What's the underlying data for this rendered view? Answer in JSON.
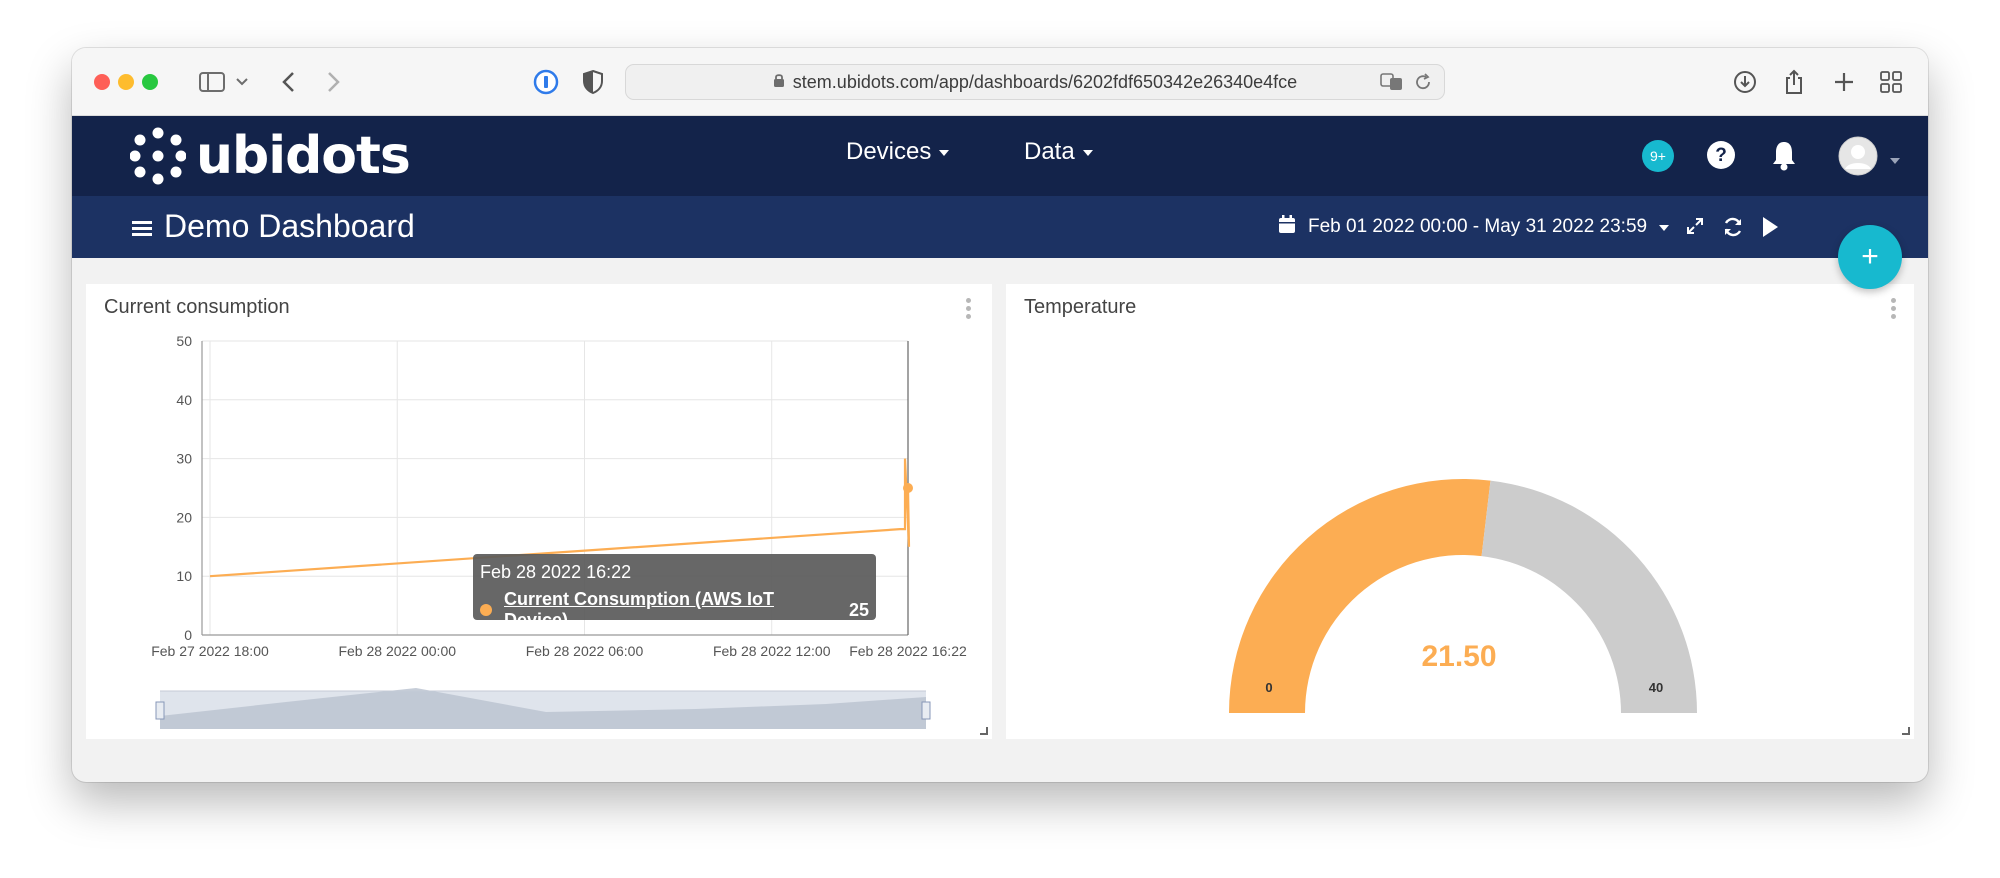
{
  "browser": {
    "url": "stem.ubidots.com/app/dashboards/6202fdf650342e26340e4fce"
  },
  "header": {
    "logo_text": "ubidots",
    "nav": [
      {
        "label": "Devices"
      },
      {
        "label": "Data"
      }
    ],
    "notifications_badge": "9+"
  },
  "dashboard": {
    "title": "Demo Dashboard",
    "date_range": "Feb 01 2022 00:00 - May 31 2022 23:59",
    "fab_label": "+"
  },
  "widgets": {
    "current": {
      "title": "Current consumption",
      "tooltip": {
        "time": "Feb 28 2022 16:22",
        "series": "Current Consumption (AWS IoT Device)",
        "value": "25"
      }
    },
    "temperature": {
      "title": "Temperature",
      "value_label": "21.50",
      "min_label": "0",
      "max_label": "40"
    }
  },
  "colors": {
    "nav_bg": "#13234a",
    "subnav_bg": "#1c3263",
    "accent": "#17b9cf",
    "series": "#fcad53",
    "gauge_rest": "#cccccc"
  },
  "chart_data": [
    {
      "type": "line",
      "title": "Current consumption",
      "x_tick_labels": [
        "Feb 27 2022 18:00",
        "Feb 28 2022 00:00",
        "Feb 28 2022 06:00",
        "Feb 28 2022 12:00",
        "Feb 28 2022 16:22"
      ],
      "y_tick_labels": [
        "0",
        "10",
        "20",
        "30",
        "40",
        "50"
      ],
      "ylim": [
        0,
        50
      ],
      "grid": true,
      "series": [
        {
          "name": "Current Consumption (AWS IoT Device)",
          "x": [
            "Feb 27 2022 18:00",
            "Feb 28 2022 16:00",
            "Feb 28 2022 16:21",
            "Feb 28 2022 16:21",
            "Feb 28 2022 16:22",
            "Feb 28 2022 16:22"
          ],
          "y": [
            10,
            18,
            18,
            30,
            15,
            25
          ]
        }
      ]
    },
    {
      "type": "gauge",
      "title": "Temperature",
      "value": 21.5,
      "min": 0,
      "max": 40
    }
  ]
}
